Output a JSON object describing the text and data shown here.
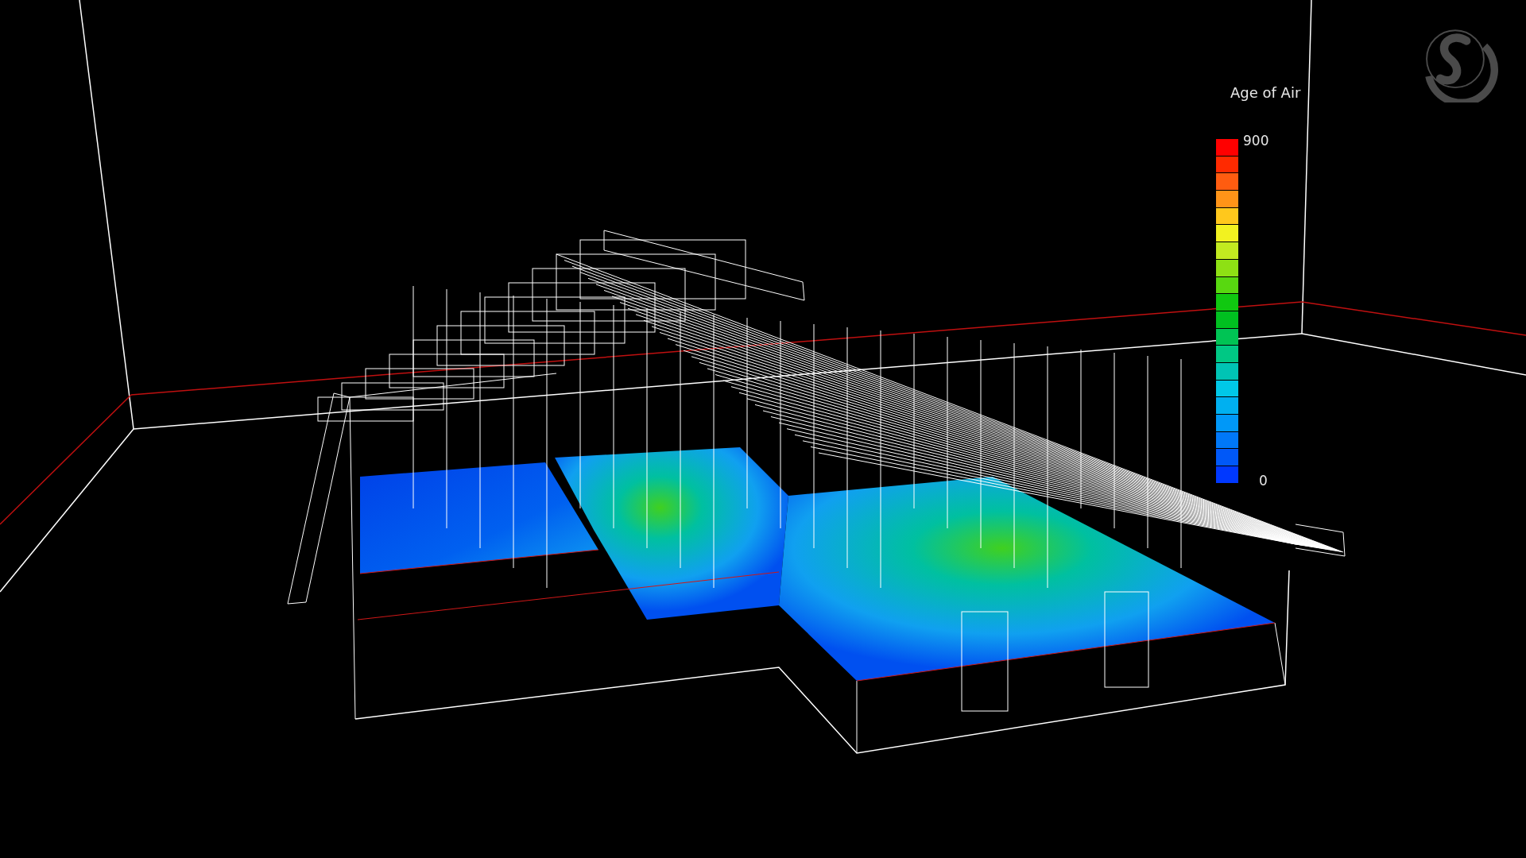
{
  "legend": {
    "title": "Age of Air",
    "max_label": "900",
    "min_label": "0",
    "bands": [
      {
        "color": "#ff0000"
      },
      {
        "color": "#ff2a00"
      },
      {
        "color": "#ff5c10"
      },
      {
        "color": "#ff9418"
      },
      {
        "color": "#ffc81c"
      },
      {
        "color": "#f2f220"
      },
      {
        "color": "#c2ea20"
      },
      {
        "color": "#8ee014"
      },
      {
        "color": "#58d810"
      },
      {
        "color": "#10c810"
      },
      {
        "color": "#00c020"
      },
      {
        "color": "#00c454"
      },
      {
        "color": "#00c884"
      },
      {
        "color": "#00c4b4"
      },
      {
        "color": "#00c8e8"
      },
      {
        "color": "#00b0f0"
      },
      {
        "color": "#0098f8"
      },
      {
        "color": "#0078f8"
      },
      {
        "color": "#0058f8"
      },
      {
        "color": "#0038ff"
      }
    ]
  }
}
